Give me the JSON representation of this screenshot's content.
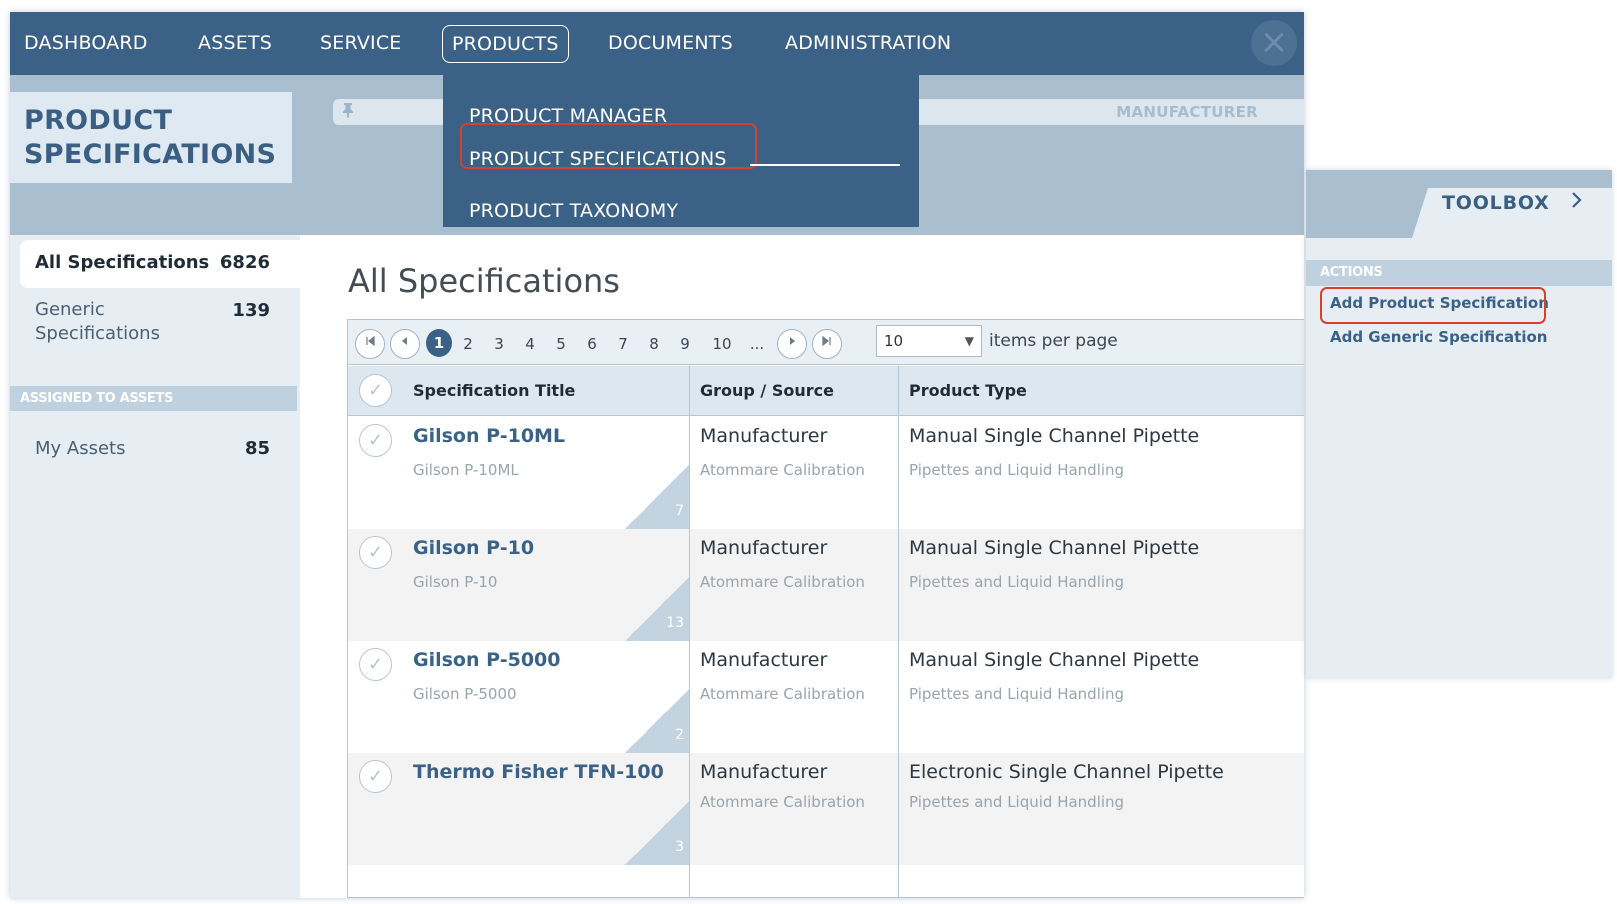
{
  "nav": {
    "items": [
      "DASHBOARD",
      "ASSETS",
      "SERVICE",
      "PRODUCTS",
      "DOCUMENTS",
      "ADMINISTRATION"
    ],
    "active": "PRODUCTS",
    "close_glyph": "×"
  },
  "products_menu": {
    "items": [
      "PRODUCT MANAGER",
      "PRODUCT SPECIFICATIONS",
      "PRODUCT TAXONOMY"
    ],
    "highlighted": "PRODUCT SPECIFICATIONS"
  },
  "page_title": {
    "line1": "PRODUCT",
    "line2": "SPECIFICATIONS"
  },
  "filter": {
    "label": "MANUFACTURER"
  },
  "sidebar": {
    "items": [
      {
        "label": "All Specifications",
        "count": "6826",
        "selected": true
      },
      {
        "label": "Generic Specifications",
        "count": "139",
        "selected": false
      }
    ],
    "section": "ASSIGNED TO ASSETS",
    "assets": [
      {
        "label": "My Assets",
        "count": "85"
      }
    ]
  },
  "main": {
    "title": "All Specifications"
  },
  "pager": {
    "pages": [
      "1",
      "2",
      "3",
      "4",
      "5",
      "6",
      "7",
      "8",
      "9",
      "10",
      "..."
    ],
    "current": "1",
    "per_page": "10",
    "per_page_label": "items per page"
  },
  "grid": {
    "columns": [
      "Specification Title",
      "Group / Source",
      "Product Type"
    ],
    "rows": [
      {
        "title": "Gilson P-10ML",
        "subtitle": "Gilson P-10ML",
        "source": "Manufacturer",
        "source_sub": "Atommare Calibration",
        "type": "Manual Single Channel Pipette",
        "type_sub": "Pipettes and Liquid Handling",
        "count": "7"
      },
      {
        "title": "Gilson P-10",
        "subtitle": "Gilson P-10",
        "source": "Manufacturer",
        "source_sub": "Atommare Calibration",
        "type": "Manual Single Channel Pipette",
        "type_sub": "Pipettes and Liquid Handling",
        "count": "13"
      },
      {
        "title": "Gilson P-5000",
        "subtitle": "Gilson P-5000",
        "source": "Manufacturer",
        "source_sub": "Atommare Calibration",
        "type": "Manual Single Channel Pipette",
        "type_sub": "Pipettes and Liquid Handling",
        "count": "2"
      },
      {
        "title": "Thermo Fisher TFN-100",
        "subtitle": "",
        "source": "Manufacturer",
        "source_sub": "Atommare Calibration",
        "type": "Electronic Single Channel Pipette",
        "type_sub": "Pipettes and Liquid Handling",
        "count": "3"
      }
    ]
  },
  "toolbox": {
    "label": "TOOLBOX",
    "section": "ACTIONS",
    "actions": [
      "Add Product Specification",
      "Add Generic Specification"
    ],
    "highlighted": "Add Product Specification"
  },
  "colors": {
    "nav_bg": "#3b6286",
    "band": "#a9bfd0",
    "sidebar_bg": "#e6eef4",
    "accent_text": "#3b6286",
    "highlight_border": "#d6402e"
  }
}
